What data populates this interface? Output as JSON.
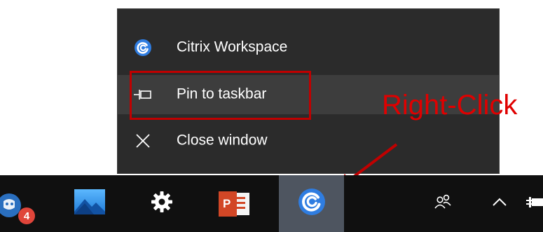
{
  "context_menu": {
    "items": [
      {
        "label": "Citrix Workspace",
        "icon": "citrix-workspace-icon"
      },
      {
        "label": "Pin to taskbar",
        "icon": "pin-icon"
      },
      {
        "label": "Close window",
        "icon": "close-icon"
      }
    ]
  },
  "annotation": {
    "text": "Right-Click",
    "color": "#e00000"
  },
  "taskbar": {
    "apps": [
      {
        "icon": "chat-app-icon",
        "badge": "4"
      },
      {
        "icon": "photos-icon"
      },
      {
        "icon": "settings-gear-icon"
      },
      {
        "icon": "powerpoint-icon"
      },
      {
        "icon": "citrix-workspace-icon",
        "active": true
      }
    ],
    "tray": [
      {
        "icon": "people-icon"
      },
      {
        "icon": "chevron-up-icon"
      },
      {
        "icon": "power-plug-icon"
      }
    ]
  },
  "colors": {
    "menu_bg": "#2b2b2b",
    "menu_hover": "#3d3d3d",
    "highlight": "#c00000",
    "taskbar_bg": "#101010",
    "taskbar_active": "#4e5560",
    "citrix_blue": "#3a86e8"
  }
}
